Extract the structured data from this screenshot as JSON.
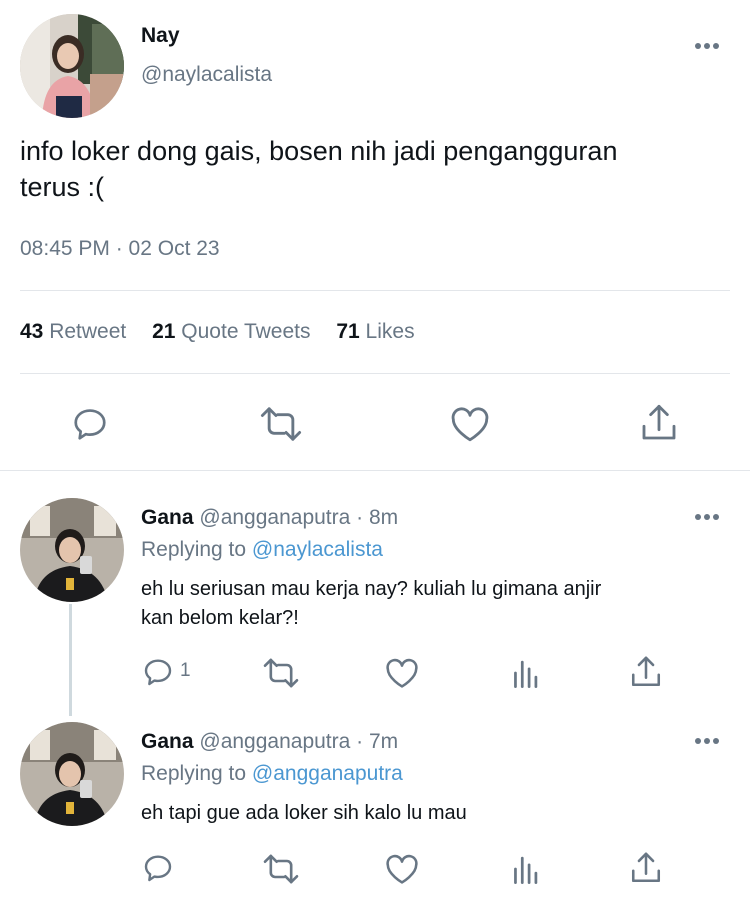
{
  "main_tweet": {
    "author_name": "Nay",
    "author_handle": "@naylacalista",
    "text_line1": "info loker dong gais, bosen nih jadi pengangguran",
    "text_line2": "terus :(",
    "timestamp": "08:45 PM · 02 Oct 23",
    "stats": {
      "retweets_count": "43",
      "retweets_label": "Retweet",
      "quotes_count": "21",
      "quotes_label": "Quote Tweets",
      "likes_count": "71",
      "likes_label": "Likes"
    }
  },
  "replies": [
    {
      "author_name": "Gana",
      "author_handle": "@angganaputra",
      "time": "· 8m",
      "replying_prefix": "Replying to",
      "replying_to": "@naylacalista",
      "text_line1": "eh lu seriusan mau kerja nay? kuliah lu gimana anjir",
      "text_line2": "kan belom kelar?!",
      "reply_count": "1"
    },
    {
      "author_name": "Gana",
      "author_handle": "@angganaputra",
      "time": "· 7m",
      "replying_prefix": "Replying to",
      "replying_to": "@angganaputra",
      "text_line1": "eh tapi gue ada loker sih kalo lu mau",
      "text_line2": "",
      "reply_count": ""
    }
  ],
  "icons": {
    "reply": "reply-icon",
    "retweet": "retweet-icon",
    "like": "like-icon",
    "share": "share-icon",
    "analytics": "analytics-icon",
    "more": "more-icon"
  },
  "colors": {
    "text": "#0f1419",
    "muted": "#687684",
    "link": "#4b97d1",
    "divider": "#e3e6ea"
  }
}
